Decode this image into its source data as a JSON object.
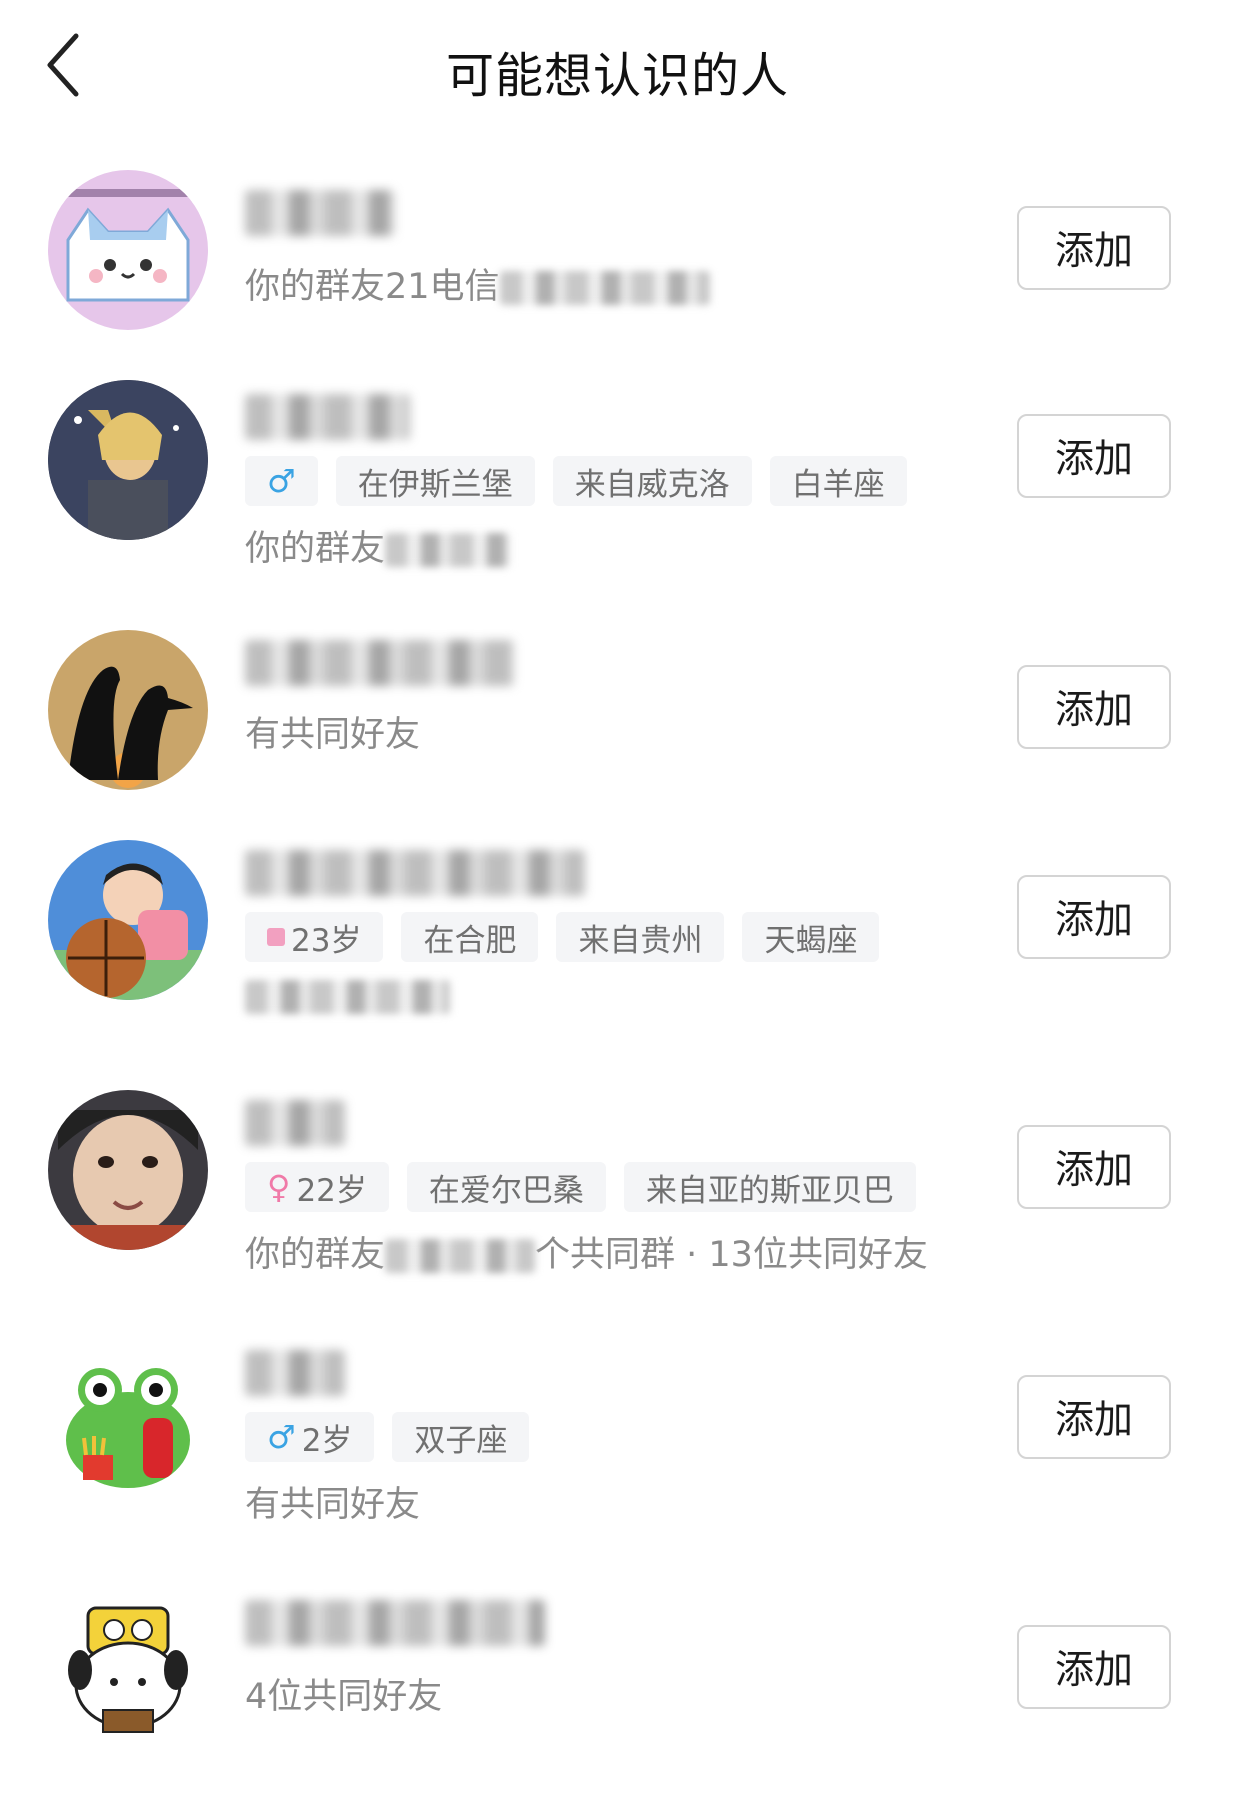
{
  "header": {
    "title": "可能想认识的人"
  },
  "add_label": "添加",
  "people": [
    {
      "relation_prefix": "你的群友21电信"
    },
    {
      "sex": "♂",
      "tags": [
        "在伊斯兰堡",
        "来自威克洛",
        "白羊座"
      ],
      "relation_prefix": "你的群友"
    },
    {
      "relation": "有共同好友"
    },
    {
      "age": "23岁",
      "tags": [
        "在合肥",
        "来自贵州",
        "天蝎座"
      ]
    },
    {
      "sex": "♀",
      "age": "22岁",
      "tags": [
        "在爱尔巴桑",
        "来自亚的斯亚贝巴"
      ],
      "relation_prefix": "你的群友",
      "relation_suffix": "个共同群 · 13位共同好友"
    },
    {
      "sex": "♂",
      "age": "2岁",
      "tags": [
        "双子座"
      ],
      "relation": "有共同好友"
    },
    {
      "relation": "4位共同好友"
    }
  ]
}
